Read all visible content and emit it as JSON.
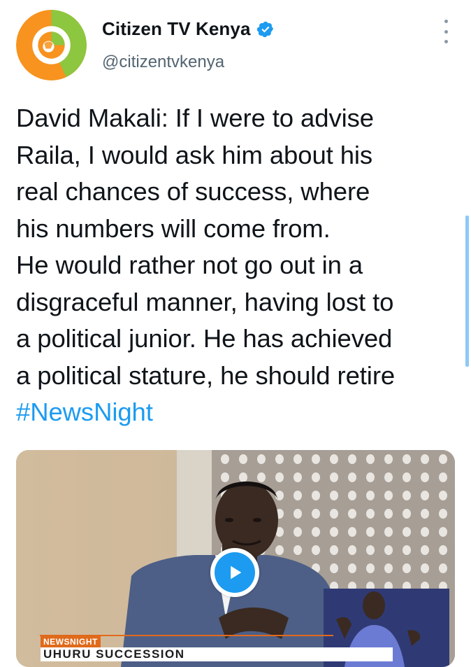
{
  "tweet": {
    "author": {
      "display_name": "Citizen TV Kenya",
      "handle": "@citizentvkenya",
      "verified": true,
      "avatar_icon": "citizen-tv-logo",
      "avatar_colors": [
        "#f7931e",
        "#8dc63f"
      ]
    },
    "more_icon": "more-vertical-icon",
    "text_lines": [
      "David Makali: If I were to advise",
      "Raila, I would ask him about his",
      "real chances of success, where",
      "his numbers will come from.",
      "He would rather not go out in a",
      "disgraceful manner, having lost to",
      "a political junior. He has achieved",
      "a political stature, he should retire"
    ],
    "hashtag": "#NewsNight",
    "media": {
      "type": "video",
      "play_icon": "play-icon",
      "lower_third_tag": "NEWSNIGHT",
      "lower_third_topic": "UHURU SUCCESSION"
    }
  },
  "colors": {
    "link": "#1d9bf0",
    "secondary_text": "#536471",
    "primary_text": "#0f1419"
  }
}
